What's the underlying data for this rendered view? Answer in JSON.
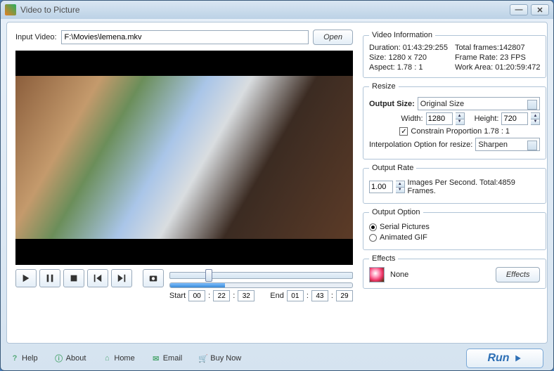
{
  "title": "Video to Picture",
  "input": {
    "label": "Input Video:",
    "value": "F:\\Movies\\lemena.mkv",
    "open": "Open"
  },
  "videoInfo": {
    "legend": "Video Information",
    "duration_l": "Duration:",
    "duration_v": "01:43:29:255",
    "total_l": "Total frames:",
    "total_v": "142807",
    "size_l": "Size:",
    "size_v": "1280 x 720",
    "rate_l": "Frame Rate:",
    "rate_v": "23 FPS",
    "aspect_l": "Aspect:",
    "aspect_v": "1.78 : 1",
    "work_l": "Work Area:",
    "work_v": "01:20:59:472"
  },
  "resize": {
    "legend": "Resize",
    "outputsize_l": "Output Size:",
    "outputsize_v": "Original Size",
    "width_l": "Width:",
    "width_v": "1280",
    "height_l": "Height:",
    "height_v": "720",
    "constrain": "Constrain Proportion  1.78 : 1",
    "interp_l": "Interpolation Option for resize:",
    "interp_v": "Sharpen"
  },
  "rate": {
    "legend": "Output Rate",
    "value": "1.00",
    "text": "Images Per Second. Total:4859 Frames."
  },
  "option": {
    "legend": "Output Option",
    "serial": "Serial Pictures",
    "gif": "Animated GIF"
  },
  "effects": {
    "legend": "Effects",
    "value": "None",
    "button": "Effects"
  },
  "time": {
    "start": "Start",
    "end": "End",
    "s0": "00",
    "s1": "22",
    "s2": "32",
    "e0": "01",
    "e1": "43",
    "e2": "29"
  },
  "footer": {
    "help": "Help",
    "about": "About",
    "home": "Home",
    "email": "Email",
    "buy": "Buy Now",
    "run": "Run"
  }
}
